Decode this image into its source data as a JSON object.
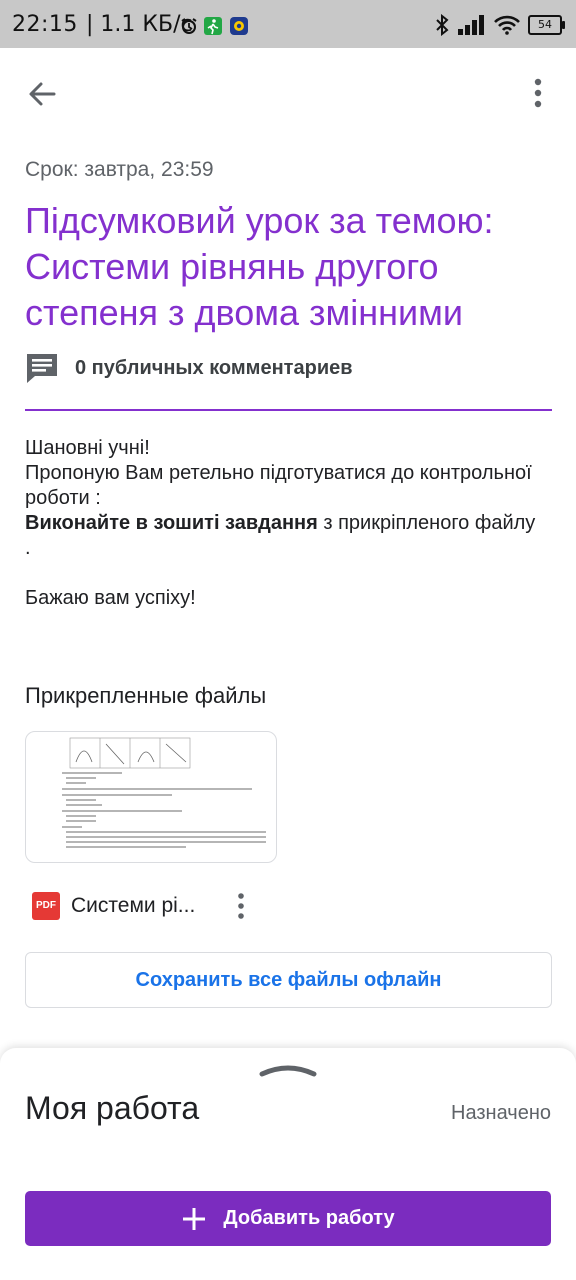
{
  "status_bar": {
    "time": "22:15",
    "network": "| 1.1 КБ/с",
    "battery": "54"
  },
  "assignment": {
    "due": "Срок: завтра, 23:59",
    "title": "Підсумковий урок за темою: Системи рівнянь другого степеня з двома змінними",
    "comments_label": "0 публичных комментариев",
    "description": {
      "line1": "Шановні учні!",
      "line2": "Пропоную Вам ретельно підготуватися до контрольної роботи :",
      "line3_bold": "Виконайте в зошиті завдання",
      "line3_rest": " з прикріпленого файлу .",
      "line4": "Бажаю вам успіху!"
    }
  },
  "files": {
    "heading": "Прикрепленные файлы",
    "items": [
      {
        "name": "Системи рі...",
        "type_label": "PDF"
      }
    ],
    "save_offline_label": "Сохранить все файлы офлайн"
  },
  "my_work": {
    "title": "Моя работа",
    "status": "Назначено",
    "add_label": "Добавить работу"
  },
  "colors": {
    "accent_purple": "#8430ce",
    "button_purple": "#7b2cbf",
    "link_blue": "#1a73e8",
    "pdf_red": "#e53935"
  }
}
